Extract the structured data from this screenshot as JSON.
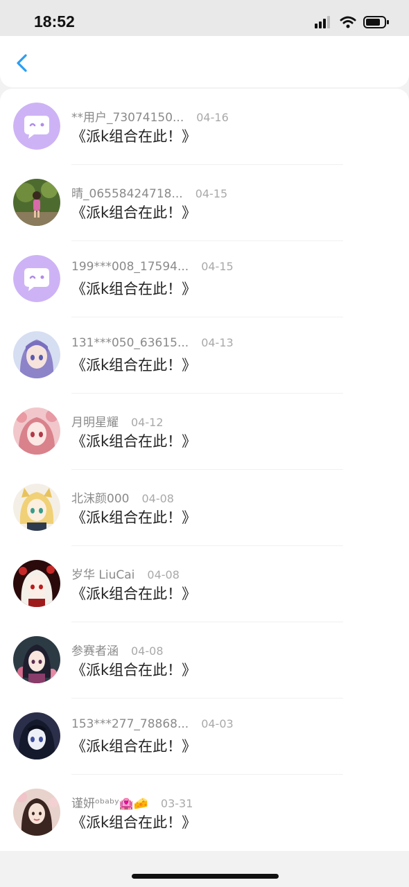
{
  "status_bar": {
    "time": "18:52"
  },
  "header": {
    "back_icon": "chevron-left-icon"
  },
  "colors": {
    "accent": "#2a9df4",
    "default_avatar_bg": "#cdb3f5"
  },
  "items": [
    {
      "name": "**用户_73074150...",
      "date": "04-16",
      "message": "《派k组合在此！》",
      "avatar": "default-bubble"
    },
    {
      "name": "晴_06558424718...",
      "date": "04-15",
      "message": "《派k组合在此！》",
      "avatar": "photo-garden"
    },
    {
      "name": "199***008_17594...",
      "date": "04-15",
      "message": "《派k组合在此！》",
      "avatar": "default-bubble"
    },
    {
      "name": "131***050_63615...",
      "date": "04-13",
      "message": "《派k组合在此！》",
      "avatar": "anime-blue"
    },
    {
      "name": "月明星耀",
      "date": "04-12",
      "message": "《派k组合在此！》",
      "avatar": "anime-pink"
    },
    {
      "name": "北沫颜000",
      "date": "04-08",
      "message": "《派k组合在此！》",
      "avatar": "anime-blonde"
    },
    {
      "name": "岁华 LiuCai",
      "date": "04-08",
      "message": "《派k组合在此！》",
      "avatar": "anime-red"
    },
    {
      "name": "参赛者涵",
      "date": "04-08",
      "message": "《派k组合在此！》",
      "avatar": "anime-kimono"
    },
    {
      "name": "153***277_78868...",
      "date": "04-03",
      "message": "《派k组合在此！》",
      "avatar": "anime-dark"
    },
    {
      "name": "谨妍ᵒᵇᵃᵇʸ🏩🧀",
      "date": "03-31",
      "message": "《派k组合在此！》",
      "avatar": "photo-woman"
    }
  ]
}
